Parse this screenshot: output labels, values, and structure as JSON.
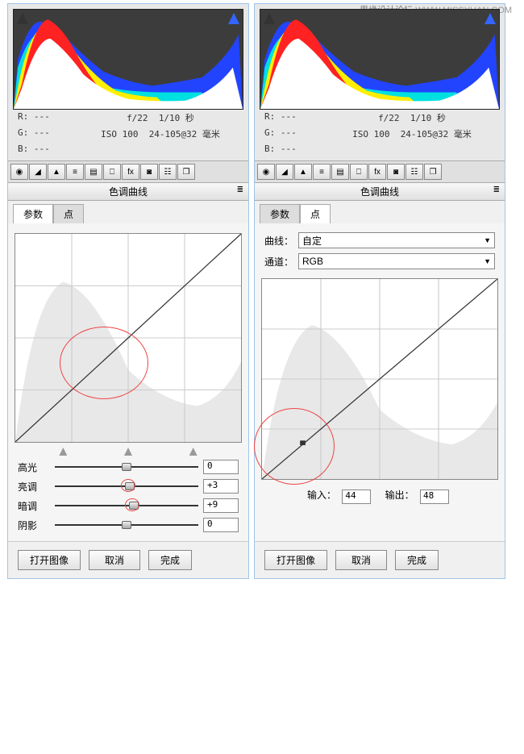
{
  "watermark": {
    "cn": "思缘设计论坛",
    "en": "WWW.MISSYUAN.COM"
  },
  "section_title": "色调曲线",
  "info": {
    "R": "R: ---",
    "G": "G: ---",
    "B": "B: ---",
    "aperture": "f/22",
    "shutter": "1/10 秒",
    "iso": "ISO 100",
    "lens": "24-105@32 毫米"
  },
  "tabs": {
    "params": "参数",
    "point": "点"
  },
  "sliders": {
    "highlight": {
      "label": "高光",
      "value": "0"
    },
    "lights": {
      "label": "亮调",
      "value": "+3"
    },
    "darks": {
      "label": "暗调",
      "value": "+9"
    },
    "shadows": {
      "label": "阴影",
      "value": "0"
    }
  },
  "curve_dropdowns": {
    "curve_label": "曲线：",
    "curve_value": "自定",
    "channel_label": "通道：",
    "channel_value": "RGB"
  },
  "io": {
    "input_label": "输入：",
    "input_value": "44",
    "output_label": "输出：",
    "output_value": "48"
  },
  "buttons": {
    "open": "打开图像",
    "cancel": "取消",
    "done": "完成",
    "done_cut": "完成"
  }
}
